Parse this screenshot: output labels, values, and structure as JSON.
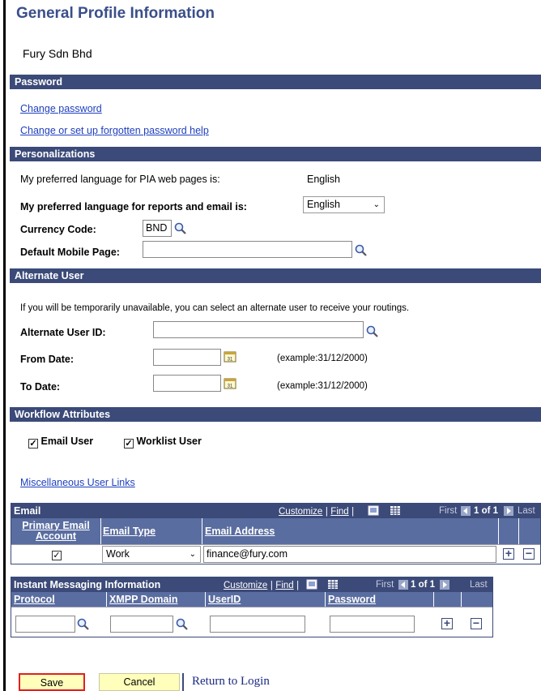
{
  "page": {
    "title": "General Profile Information",
    "company": "Fury Sdn Bhd"
  },
  "password": {
    "header": "Password",
    "change_password": "Change password",
    "forgot_help": "Change or set up forgotten password help"
  },
  "personalizations": {
    "header": "Personalizations",
    "pia_language_label": "My preferred language for PIA web pages is:",
    "pia_language_value": "English",
    "report_language_label": "My preferred language for reports and email is:",
    "report_language_value": "English",
    "currency_label": "Currency Code:",
    "currency_value": "BND",
    "mobile_page_label": "Default Mobile Page:",
    "mobile_page_value": ""
  },
  "alternate_user": {
    "header": "Alternate User",
    "info": "If you will be temporarily unavailable, you can select an alternate user to receive your routings.",
    "user_id_label": "Alternate User ID:",
    "user_id_value": "",
    "from_date_label": "From Date:",
    "from_date_value": "",
    "from_date_example": "(example:31/12/2000)",
    "to_date_label": "To Date:",
    "to_date_value": "",
    "to_date_example": "(example:31/12/2000)"
  },
  "workflow": {
    "header": "Workflow Attributes",
    "email_user_label": "Email User",
    "email_user_checked": true,
    "worklist_user_label": "Worklist User",
    "worklist_user_checked": true
  },
  "misc": {
    "link": "Miscellaneous User Links"
  },
  "email_grid": {
    "header": "Email",
    "customize": "Customize",
    "sep": "|",
    "find": "Find",
    "first": "First",
    "range": "1 of 1",
    "last": "Last",
    "columns": {
      "primary_line1": "Primary Email",
      "primary_line2": "Account",
      "email_type": "Email Type",
      "email_address": "Email Address"
    },
    "rows": [
      {
        "primary": true,
        "email_type": "Work",
        "email_address": "finance@fury.com"
      }
    ]
  },
  "im_grid": {
    "header": "Instant Messaging Information",
    "customize": "Customize",
    "sep": "|",
    "find": "Find",
    "first": "First",
    "range": "1 of 1",
    "last": "Last",
    "columns": {
      "protocol": "Protocol",
      "xmpp_domain": "XMPP Domain",
      "userid": "UserID",
      "password": "Password"
    },
    "rows": [
      {
        "protocol": "",
        "xmpp_domain": "",
        "userid": "",
        "password": ""
      }
    ]
  },
  "footer": {
    "save": "Save",
    "cancel": "Cancel",
    "return": "Return to Login"
  },
  "colors": {
    "section_bar": "#3b4a78",
    "column_header": "#5a6da0",
    "title": "#3a4f8a",
    "link": "#1f3fbf",
    "button_bg": "#ffffbb",
    "save_border": "#e02020"
  }
}
